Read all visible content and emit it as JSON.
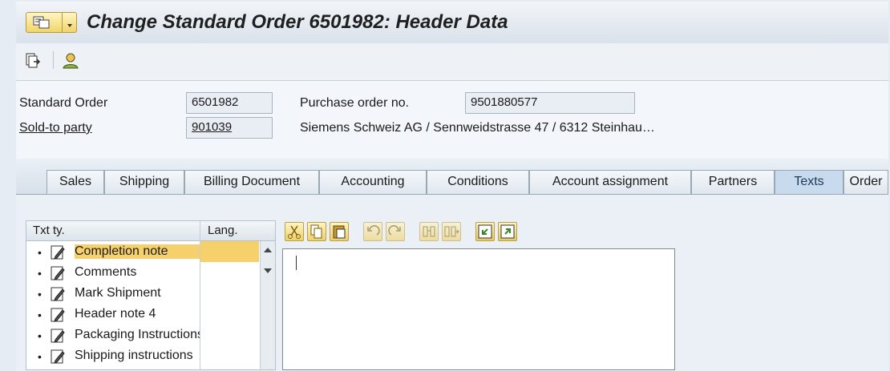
{
  "window": {
    "title": "Change Standard Order 6501982: Header Data"
  },
  "toolbar": {
    "icons": [
      "display-document-flow-icon",
      "person-icon"
    ]
  },
  "header": {
    "standard_order_label": "Standard Order",
    "standard_order_value": "6501982",
    "po_label": "Purchase order no.",
    "po_value": "9501880577",
    "sold_to_label": "Sold-to party",
    "sold_to_value": "901039",
    "sold_to_desc": "Siemens Schweiz AG / Sennweidstrasse 47 / 6312 Steinhau…"
  },
  "tabs": [
    {
      "label": "Sales"
    },
    {
      "label": "Shipping"
    },
    {
      "label": "Billing Document"
    },
    {
      "label": "Accounting"
    },
    {
      "label": "Conditions"
    },
    {
      "label": "Account assignment"
    },
    {
      "label": "Partners"
    },
    {
      "label": "Texts",
      "active": true
    },
    {
      "label": "Order"
    }
  ],
  "texts": {
    "col_txt_type": "Txt ty.",
    "col_lang": "Lang.",
    "items": [
      {
        "label": "Completion note",
        "selected": true
      },
      {
        "label": "Comments"
      },
      {
        "label": "Mark Shipment"
      },
      {
        "label": "Header note 4"
      },
      {
        "label": "Packaging Instructions"
      },
      {
        "label": "Shipping instructions"
      }
    ],
    "editor_toolbar": [
      "cut-icon",
      "copy-icon",
      "paste-icon",
      "undo-icon",
      "redo-icon",
      "find-icon",
      "find-next-icon",
      "import-icon",
      "export-icon"
    ]
  },
  "colors": {
    "accent": "#f6d16b",
    "active_tab": "#c8daee"
  }
}
